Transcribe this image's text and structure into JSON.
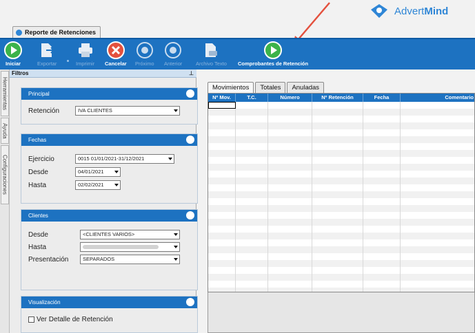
{
  "brand": {
    "name_regular": "Advert",
    "name_bold": "Mind",
    "accent": "#2f86d6",
    "highlight_arrow_color": "#e4513e"
  },
  "document_tab": {
    "title": "Reporte de Retenciones"
  },
  "toolbar": {
    "buttons": [
      {
        "label": "Iniciar",
        "icon": "play-icon",
        "enabled": true
      },
      {
        "label": "Exportar",
        "icon": "export-icon",
        "enabled": false
      },
      {
        "label": "Imprimir",
        "icon": "printer-icon",
        "enabled": false
      },
      {
        "label": "Cancelar",
        "icon": "cancel-icon",
        "enabled": true
      },
      {
        "label": "Próximo",
        "icon": "next-icon",
        "enabled": false
      },
      {
        "label": "Anterior",
        "icon": "previous-icon",
        "enabled": false
      },
      {
        "label": "Archivo Texto",
        "icon": "text-file-icon",
        "enabled": false
      },
      {
        "label": "Comprobantes de Retención",
        "icon": "play-icon",
        "enabled": true
      }
    ]
  },
  "side_tabs": [
    "Herramientas",
    "Ayuda",
    "Configuraciones"
  ],
  "filters": {
    "title": "Filtros",
    "pin_glyph": "⊥",
    "principal": {
      "title": "Principal",
      "retencion_label": "Retención",
      "retencion_value": "IVA CLIENTES"
    },
    "fechas": {
      "title": "Fechas",
      "ejercicio_label": "Ejercicio",
      "ejercicio_value": "0015 01/01/2021-31/12/2021",
      "desde_label": "Desde",
      "desde_value": "04/01/2021",
      "hasta_label": "Hasta",
      "hasta_value": "02/02/2021"
    },
    "clientes": {
      "title": "Clientes",
      "desde_label": "Desde",
      "desde_value": "<CLIENTES VARIOS>",
      "hasta_label": "Hasta",
      "presentacion_label": "Presentación",
      "presentacion_value": "SEPARADOS"
    },
    "visualizacion": {
      "title": "Visualización",
      "detalle_label": "Ver Detalle de Retención",
      "detalle_checked": false
    }
  },
  "results": {
    "tabs": [
      "Movimientos",
      "Totales",
      "Anuladas"
    ],
    "active_tab": "Movimientos",
    "columns": [
      "Nº Mov.",
      "T.C.",
      "Número",
      "Nº Retención",
      "Fecha",
      "Comentario"
    ]
  }
}
